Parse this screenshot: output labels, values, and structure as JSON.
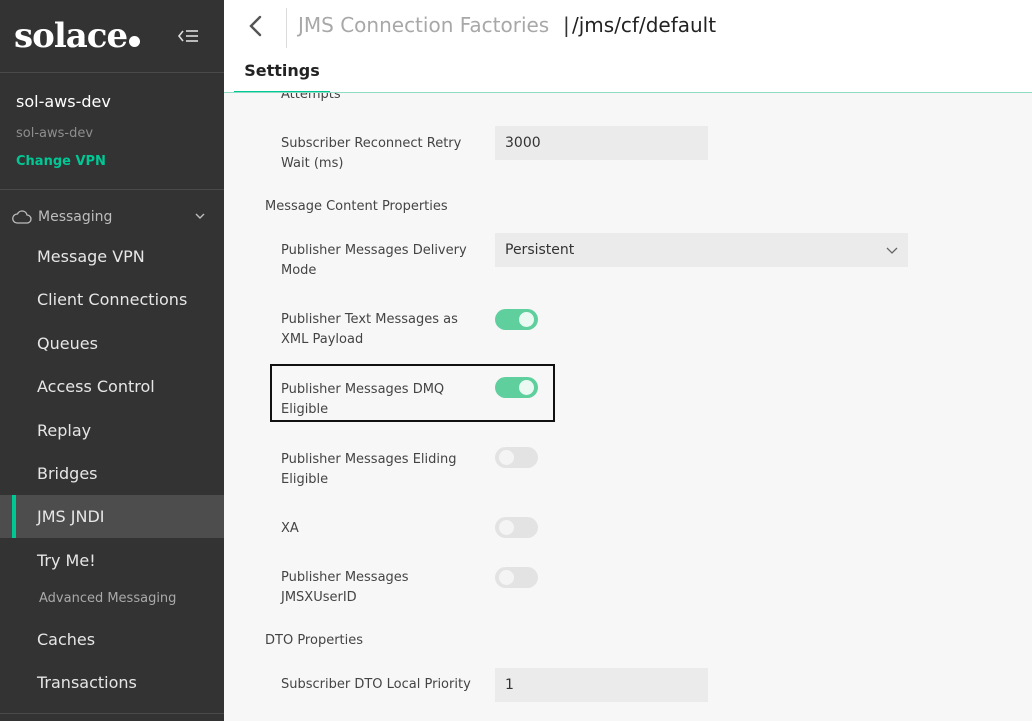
{
  "sidebar": {
    "brand": "solace",
    "vpn_name": "sol-aws-dev",
    "vpn_sub": "sol-aws-dev",
    "change_vpn": "Change VPN",
    "section_label": "Messaging",
    "items": [
      {
        "label": "Message VPN"
      },
      {
        "label": "Client Connections"
      },
      {
        "label": "Queues"
      },
      {
        "label": "Access Control"
      },
      {
        "label": "Replay"
      },
      {
        "label": "Bridges"
      },
      {
        "label": "JMS JNDI",
        "active": true
      },
      {
        "label": "Try Me!"
      },
      {
        "label": "Caches"
      },
      {
        "label": "Transactions"
      }
    ],
    "subsection_label": "Advanced Messaging"
  },
  "header": {
    "breadcrumb": "JMS Connection Factories",
    "separator": "|",
    "current": "/jms/cf/default",
    "tab": "Settings"
  },
  "form": {
    "cut_label": "Attempts",
    "reconnect_wait_label": "Subscriber Reconnect Retry Wait (ms)",
    "reconnect_wait_value": "3000",
    "content_group": "Message Content Properties",
    "delivery_mode_label": "Publisher Messages Delivery Mode",
    "delivery_mode_value": "Persistent",
    "text_xml_label": "Publisher Text Messages as XML Payload",
    "text_xml_on": true,
    "dmq_label": "Publisher Messages DMQ Eligible",
    "dmq_on": true,
    "eliding_label": "Publisher Messages Eliding Eligible",
    "eliding_on": false,
    "xa_label": "XA",
    "xa_on": false,
    "userid_label": "Publisher Messages JMSXUserID",
    "userid_on": false,
    "dto_group": "DTO Properties",
    "dto_priority_label": "Subscriber DTO Local Priority",
    "dto_priority_value": "1"
  },
  "colors": {
    "accent": "#00c895",
    "toggle_on": "#5fcf9e",
    "sidebar_bg": "#333333"
  }
}
